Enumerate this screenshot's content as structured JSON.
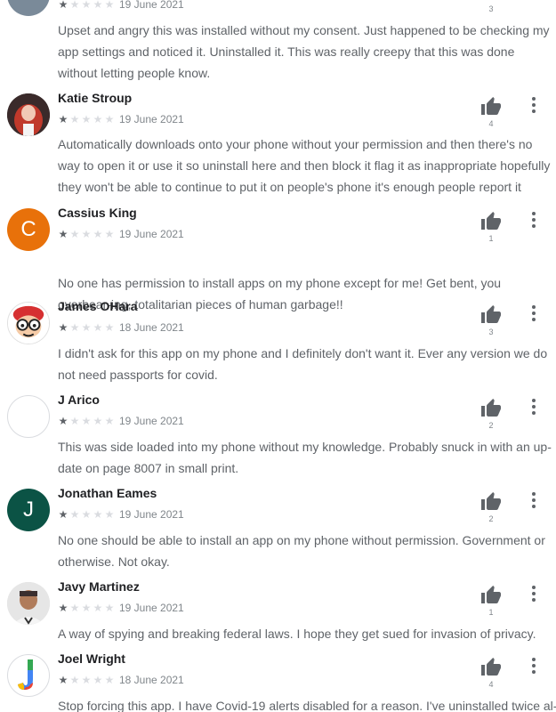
{
  "reviews": [
    {
      "author": "",
      "date": "19 June 2021",
      "rating": 1,
      "helpful_count": "3",
      "text": "Upset and angry this was installed without my consent. Just happened to be checking my app settings and noticed it. Uninstalled it. This was really creepy that this was done without letting people know."
    },
    {
      "author": "Katie Stroup",
      "date": "19 June 2021",
      "rating": 1,
      "helpful_count": "4",
      "text": "Automatically downloads onto your phone without your permission and then there's no way to open it or use it so uninstall here and then block it flag it as inappropriate hopefully they won't be able to continue to put it on people's phone it's enough people report it"
    },
    {
      "author": "Cassius King",
      "date": "19 June 2021",
      "rating": 1,
      "helpful_count": "1",
      "avatar_letter": "C",
      "avatar_color": "#e8710a",
      "text": "No one has permission to install apps on my phone except for me! Get bent, you overbear-ing, totalitarian pieces of human garbage!!"
    },
    {
      "author": "James OHara",
      "date": "18 June 2021",
      "rating": 1,
      "helpful_count": "3",
      "text": "I didn't ask for this app on my phone and I definitely don't want it. Ever any version we do not need passports for covid."
    },
    {
      "author": "J Arico",
      "date": "19 June 2021",
      "rating": 1,
      "helpful_count": "2",
      "text": "This was side loaded into my phone without my knowledge. Probably snuck in with an up-date on page 8007 in small print."
    },
    {
      "author": "Jonathan Eames",
      "date": "19 June 2021",
      "rating": 1,
      "helpful_count": "2",
      "avatar_letter": "J",
      "avatar_color": "#0b5345",
      "text": "No one should be able to install an app on my phone without permission. Government or otherwise. Not okay."
    },
    {
      "author": "Javy Martinez",
      "date": "19 June 2021",
      "rating": 1,
      "helpful_count": "1",
      "text": "A way of spying and breaking federal laws. I hope they get sued for invasion of privacy."
    },
    {
      "author": "Joel Wright",
      "date": "18 June 2021",
      "rating": 1,
      "helpful_count": "4",
      "text": "Stop forcing this app. I have Covid-19 alerts disabled for a reason. I've uninstalled twice al-"
    }
  ]
}
